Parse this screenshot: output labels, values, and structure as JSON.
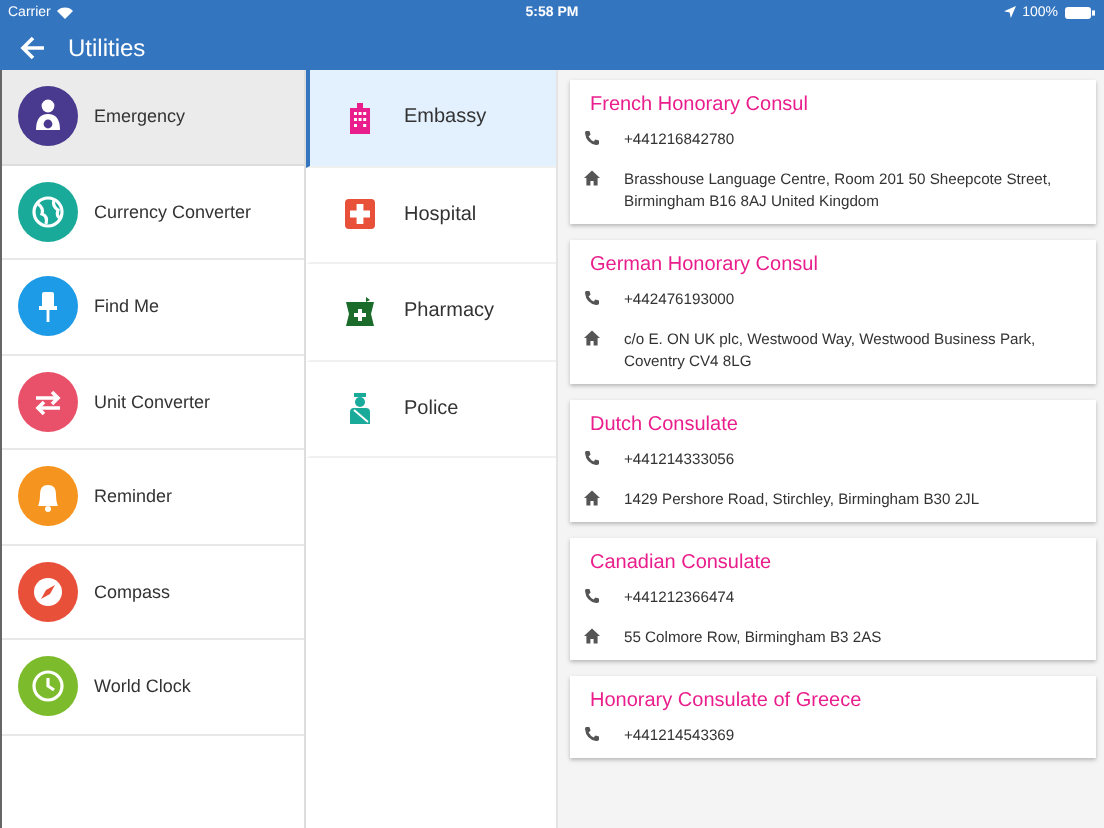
{
  "status_bar": {
    "carrier": "Carrier",
    "time": "5:58 PM",
    "battery": "100%"
  },
  "app_bar": {
    "title": "Utilities"
  },
  "categories": [
    {
      "label": "Emergency",
      "kind": "person",
      "color": "#4a3a8f",
      "selected": true
    },
    {
      "label": "Currency Converter",
      "kind": "globe",
      "color": "#1aaa9a",
      "selected": false
    },
    {
      "label": "Find Me",
      "kind": "pin",
      "color": "#1e9be6",
      "selected": false
    },
    {
      "label": "Unit Converter",
      "kind": "arrows",
      "color": "#e9516a",
      "selected": false
    },
    {
      "label": "Reminder",
      "kind": "bell",
      "color": "#f5951f",
      "selected": false
    },
    {
      "label": "Compass",
      "kind": "compass",
      "color": "#e8503a",
      "selected": false
    },
    {
      "label": "World Clock",
      "kind": "clock",
      "color": "#7cbb2b",
      "selected": false
    }
  ],
  "subcategories": [
    {
      "label": "Embassy",
      "kind": "building",
      "selected": true
    },
    {
      "label": "Hospital",
      "kind": "hospital",
      "selected": false
    },
    {
      "label": "Pharmacy",
      "kind": "pharmacy",
      "selected": false
    },
    {
      "label": "Police",
      "kind": "police",
      "selected": false
    }
  ],
  "places": [
    {
      "name": "French Honorary Consul",
      "phone": "+441216842780",
      "address": "Brasshouse Language Centre, Room 201 50 Sheepcote Street, Birmingham B16 8AJ United Kingdom"
    },
    {
      "name": "German Honorary Consul",
      "phone": "+442476193000",
      "address": "c/o E. ON UK plc, Westwood Way, Westwood Business Park, Coventry CV4 8LG"
    },
    {
      "name": "Dutch Consulate",
      "phone": "+441214333056",
      "address": "1429 Pershore Road, Stirchley, Birmingham B30 2JL"
    },
    {
      "name": "Canadian Consulate",
      "phone": "+441212366474",
      "address": "55 Colmore Row, Birmingham B3 2AS"
    },
    {
      "name": "Honorary Consulate of Greece",
      "phone": "+441214543369"
    }
  ]
}
